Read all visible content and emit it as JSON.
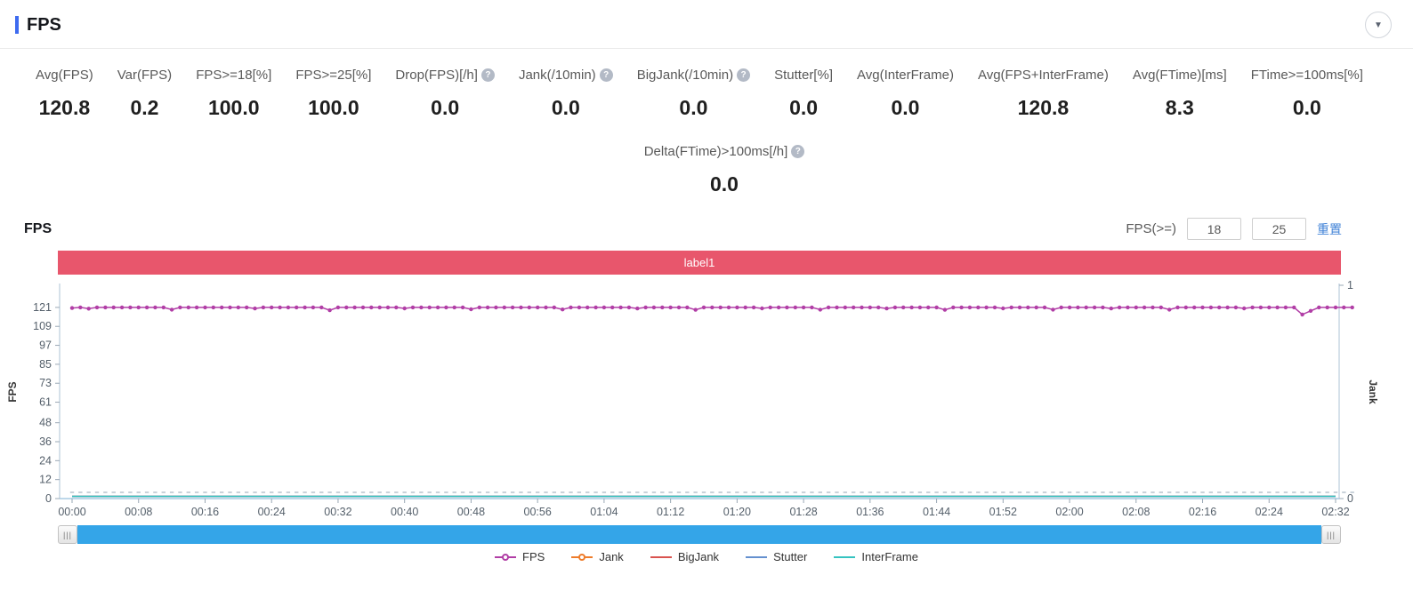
{
  "header": {
    "title": "FPS",
    "collapse_icon": "chevron-down-icon"
  },
  "metrics": {
    "row1": [
      {
        "label": "Avg(FPS)",
        "value": "120.8",
        "help": false
      },
      {
        "label": "Var(FPS)",
        "value": "0.2",
        "help": false
      },
      {
        "label": "FPS>=18[%]",
        "value": "100.0",
        "help": false
      },
      {
        "label": "FPS>=25[%]",
        "value": "100.0",
        "help": false
      },
      {
        "label": "Drop(FPS)[/h]",
        "value": "0.0",
        "help": true
      },
      {
        "label": "Jank(/10min)",
        "value": "0.0",
        "help": true
      },
      {
        "label": "BigJank(/10min)",
        "value": "0.0",
        "help": true
      },
      {
        "label": "Stutter[%]",
        "value": "0.0",
        "help": false
      },
      {
        "label": "Avg(InterFrame)",
        "value": "0.0",
        "help": false
      },
      {
        "label": "Avg(FPS+InterFrame)",
        "value": "120.8",
        "help": false
      },
      {
        "label": "Avg(FTime)[ms]",
        "value": "8.3",
        "help": false
      },
      {
        "label": "FTime>=100ms[%]",
        "value": "0.0",
        "help": false
      }
    ],
    "row2": [
      {
        "label": "Delta(FTime)>100ms[/h]",
        "value": "0.0",
        "help": true
      }
    ]
  },
  "chart_section": {
    "heading": "FPS",
    "filter_label": "FPS(>=)",
    "filter_min": "18",
    "filter_max": "25",
    "reset_label": "重置",
    "banner": {
      "text": "label1",
      "color": "#e8566c"
    }
  },
  "chart_data": {
    "type": "line",
    "title": "FPS",
    "x_tick_labels": [
      "00:00",
      "00:08",
      "00:16",
      "00:24",
      "00:32",
      "00:40",
      "00:48",
      "00:56",
      "01:04",
      "01:12",
      "01:20",
      "01:28",
      "01:36",
      "01:44",
      "01:52",
      "02:00",
      "02:08",
      "02:16",
      "02:24",
      "02:32"
    ],
    "x_tick_interval_seconds": 8,
    "x_max_seconds": 152,
    "left_axis": {
      "label": "FPS",
      "ticks": [
        0,
        12,
        24,
        36,
        48,
        61,
        73,
        85,
        97,
        109,
        121
      ],
      "max": 135
    },
    "right_axis": {
      "label": "Jank",
      "ticks": [
        0,
        1
      ],
      "max": 1
    },
    "axis_color": "#c9d7e4",
    "baseline_color": "#a9cbe4",
    "zero_dash_color": "#b3bfca",
    "series": [
      {
        "name": "FPS",
        "color": "#b13ea6",
        "axis": "left",
        "values": [
          120.6,
          121,
          120.2,
          121,
          121,
          121,
          121,
          121,
          121,
          121,
          121,
          121,
          119.6,
          121,
          121,
          121,
          121,
          121,
          121,
          121,
          121,
          121,
          120.3,
          121,
          121,
          121,
          121,
          121,
          121,
          121,
          121,
          119.2,
          121,
          121,
          121,
          121,
          121,
          121,
          121,
          121,
          120.4,
          121,
          121,
          121,
          121,
          121,
          121,
          121,
          119.8,
          121,
          121,
          121,
          121,
          121,
          121,
          121,
          121,
          121,
          121,
          119.7,
          121,
          121,
          121,
          121,
          121,
          121,
          121,
          121,
          120.3,
          121,
          121,
          121,
          121,
          121,
          121,
          119.5,
          121,
          121,
          121,
          121,
          121,
          121,
          121,
          120.4,
          121,
          121,
          121,
          121,
          121,
          121,
          119.6,
          121,
          121,
          121,
          121,
          121,
          121,
          121,
          120.3,
          121,
          121,
          121,
          121,
          121,
          121,
          119.5,
          121,
          121,
          121,
          121,
          121,
          121,
          120.4,
          121,
          121,
          121,
          121,
          121,
          119.6,
          121,
          121,
          121,
          121,
          121,
          121,
          120.3,
          121,
          121,
          121,
          121,
          121,
          121,
          119.6,
          121,
          121,
          121,
          121,
          121,
          121,
          121,
          121,
          120.4,
          121,
          121,
          121,
          121,
          121,
          121,
          116.5,
          118.8,
          121,
          121,
          121,
          121,
          121
        ]
      },
      {
        "name": "Jank",
        "color": "#ee7c2b",
        "axis": "right",
        "constant_value": 0
      },
      {
        "name": "BigJank",
        "color": "#d9534f",
        "axis": "right",
        "constant_value": 0
      },
      {
        "name": "Stutter",
        "color": "#6590cf",
        "axis": "right",
        "constant_value": 0
      },
      {
        "name": "InterFrame",
        "color": "#35c3c0",
        "axis": "right",
        "constant_value": 0
      }
    ],
    "legend": [
      {
        "name": "FPS",
        "color": "#b13ea6",
        "marker": "circle"
      },
      {
        "name": "Jank",
        "color": "#ee7c2b",
        "marker": "circle"
      },
      {
        "name": "BigJank",
        "color": "#d9534f",
        "marker": "line"
      },
      {
        "name": "Stutter",
        "color": "#6590cf",
        "marker": "line"
      },
      {
        "name": "InterFrame",
        "color": "#35c3c0",
        "marker": "line"
      }
    ]
  }
}
